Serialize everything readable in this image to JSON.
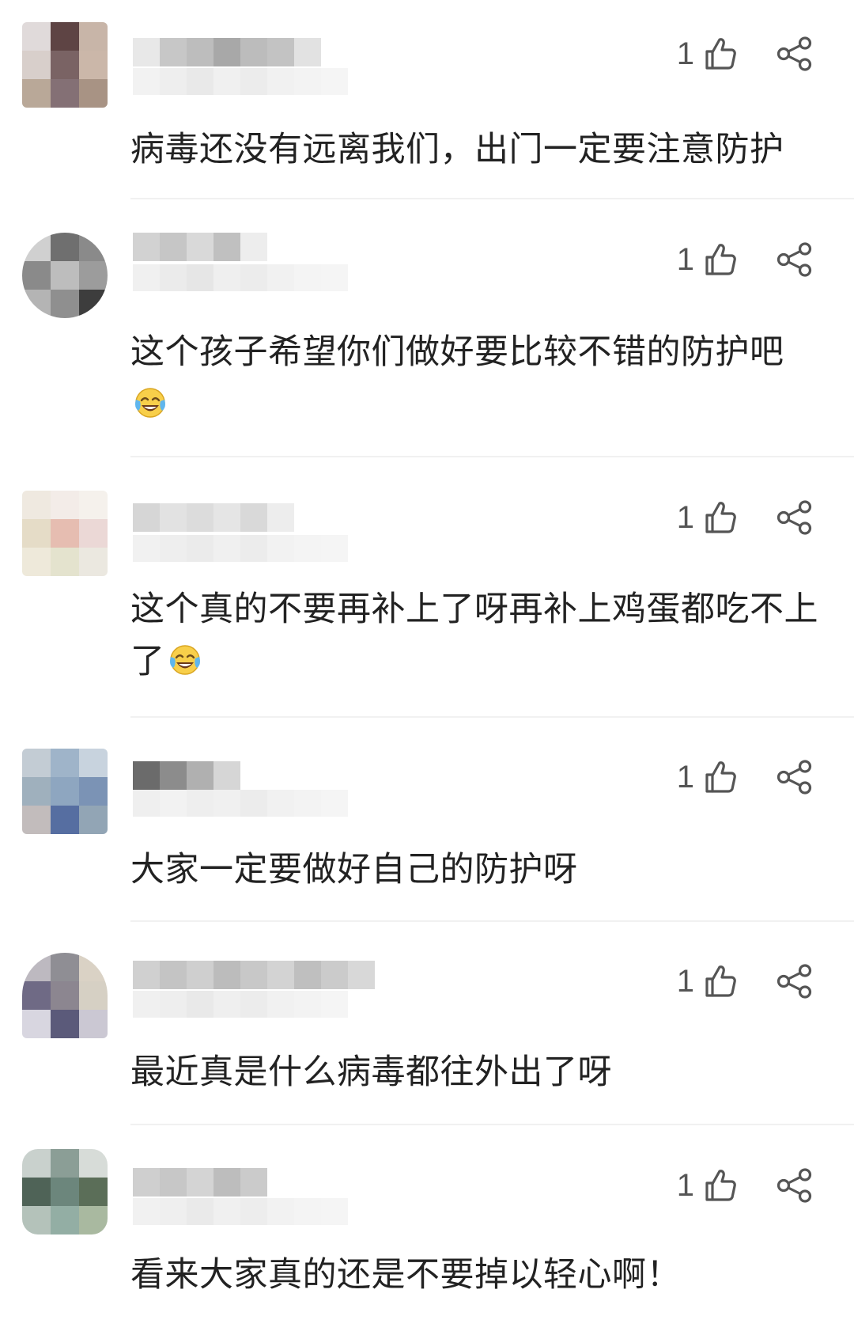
{
  "comments": [
    {
      "like_count": "1",
      "text": "病毒还没有远离我们，出门一定要注意防护",
      "has_emoji": false,
      "avatar_colors": [
        "#e0dada",
        "#5e4444",
        "#c8b5a8",
        "#d8cfcb",
        "#7a6364",
        "#cbb7a9",
        "#b9a898",
        "#847075",
        "#a89384"
      ]
    },
    {
      "like_count": "1",
      "text": "这个孩子希望你们做好要比较不错的防护吧",
      "has_emoji": true,
      "emoji": "face-with-tears-of-joy-emoji",
      "avatar_colors": [
        "#d0d0d0",
        "#6f6f6f",
        "#8a8a8a",
        "#8a8a8a",
        "#bdbdbd",
        "#9c9c9c",
        "#b4b4b4",
        "#8f8f8f",
        "#3d3d3d"
      ]
    },
    {
      "like_count": "1",
      "text": "这个真的不要再补上了呀再补上鸡蛋都吃不上了",
      "has_emoji": true,
      "emoji": "face-with-tears-of-joy-emoji",
      "avatar_colors": [
        "#efe9e0",
        "#f3ece8",
        "#f5f1ec",
        "#e5dcc7",
        "#e6bdb1",
        "#ebd8d6",
        "#eee9da",
        "#e4e3ce",
        "#ebe8e0"
      ]
    },
    {
      "like_count": "1",
      "text": "大家一定要做好自己的防护呀",
      "has_emoji": false,
      "avatar_colors": [
        "#c3ccd4",
        "#9fb4c9",
        "#c8d3de",
        "#9fb0bd",
        "#8ea6c0",
        "#7b93b5",
        "#c2bcbc",
        "#566ea1",
        "#92a5b5"
      ]
    },
    {
      "like_count": "1",
      "text": "最近真是什么病毒都往外出了呀",
      "has_emoji": false,
      "avatar_colors": [
        "#bdb9c0",
        "#8f8e94",
        "#dad2c5",
        "#6f6a85",
        "#8c8690",
        "#d6d0c4",
        "#d8d6e0",
        "#5b5a7a",
        "#cbc8d3"
      ]
    },
    {
      "like_count": "1",
      "text": "看来大家真的还是不要掉以轻心啊！",
      "has_emoji": false,
      "avatar_colors": [
        "#c9d1cd",
        "#8b9e96",
        "#d7dcd8",
        "#4f6357",
        "#6c867c",
        "#5b6e58",
        "#b4c2ba",
        "#93aea4",
        "#a9b9a0"
      ]
    }
  ],
  "icons": {
    "like": "thumbs-up-outline-icon",
    "share": "share-nodes-icon"
  },
  "colors": {
    "text": "#222222",
    "icon": "#555555",
    "divider": "#f1f1f1"
  }
}
